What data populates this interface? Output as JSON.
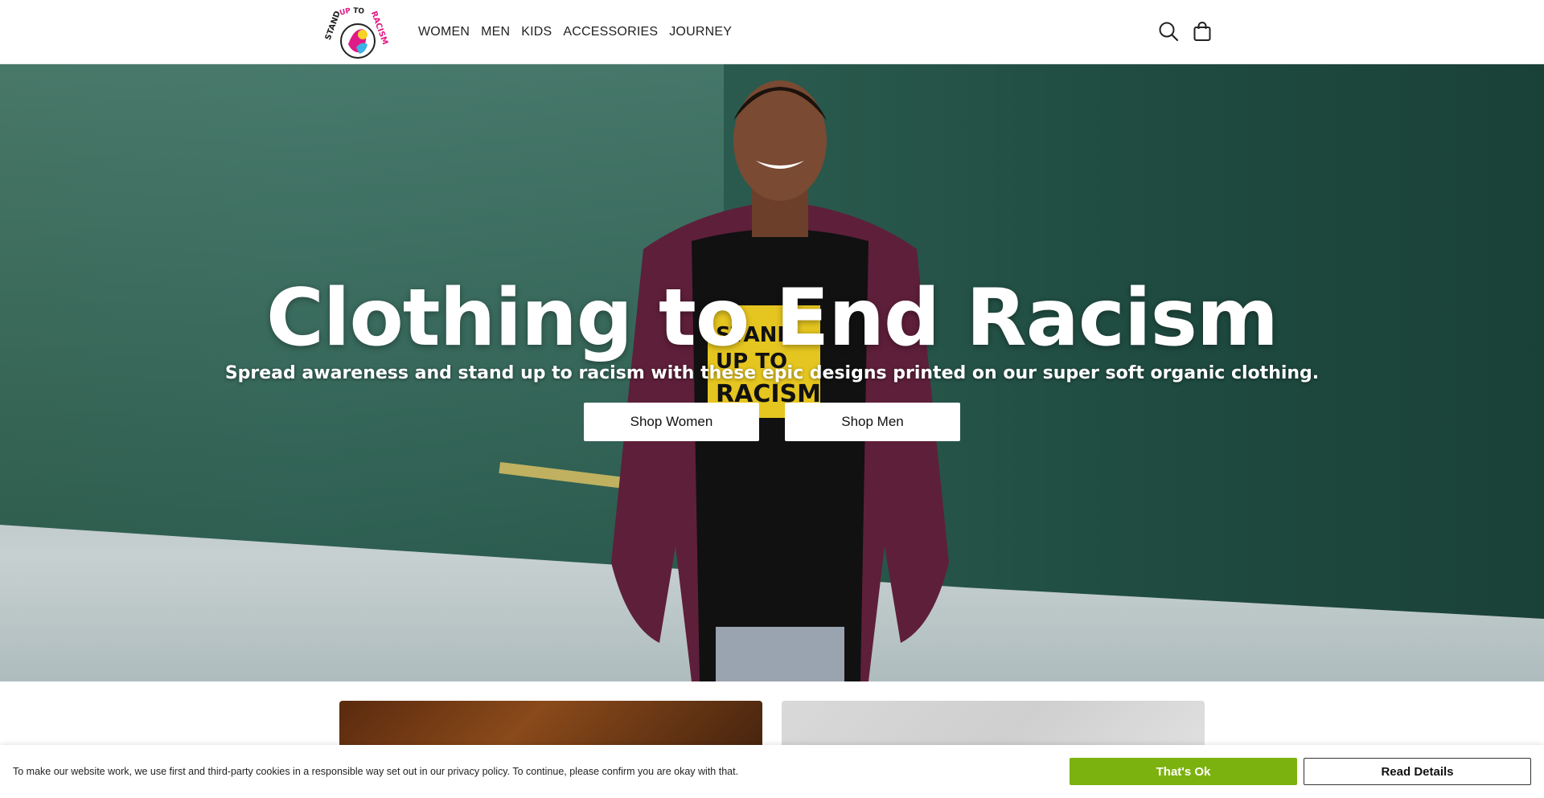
{
  "header": {
    "logo_alt": "STAND UP TO RACISM",
    "nav": [
      {
        "label": "WOMEN"
      },
      {
        "label": "MEN"
      },
      {
        "label": "KIDS"
      },
      {
        "label": "ACCESSORIES"
      },
      {
        "label": "JOURNEY"
      }
    ],
    "search_icon": "search-icon",
    "cart_icon": "shopping-bag-icon"
  },
  "hero": {
    "title": "Clothing to End Racism",
    "subtitle": "Spread awareness and stand up to racism with these epic designs printed on our super soft organic clothing.",
    "buttons": {
      "shop_women": "Shop Women",
      "shop_men": "Shop Men"
    },
    "shirt_text": "STAND UP TO RACISM"
  },
  "cookie": {
    "text": "To make our website work, we use first and third-party cookies in a responsible way set out in our privacy policy. To continue, please confirm you are okay with that.",
    "accept_label": "That's Ok",
    "details_label": "Read Details",
    "accept_color": "#7cb20f"
  }
}
